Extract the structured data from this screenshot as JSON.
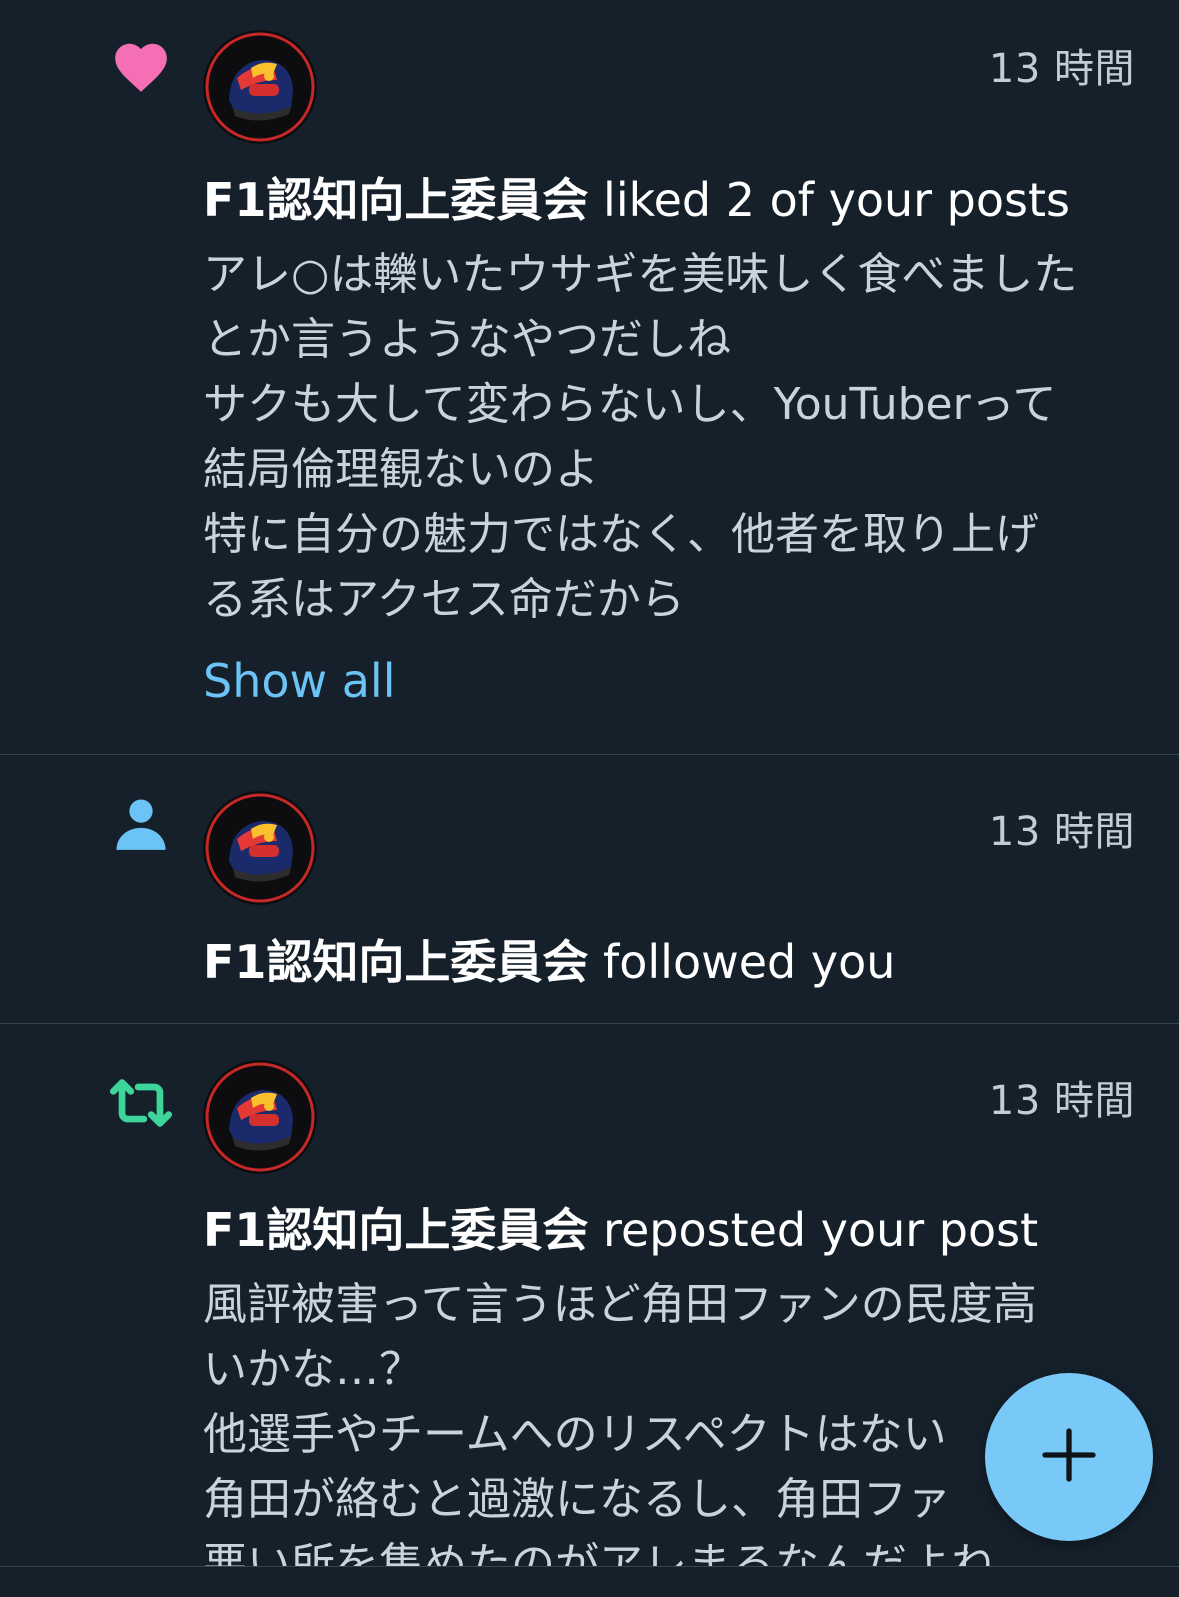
{
  "colors": {
    "background": "#15202b",
    "like": "#f46fb3",
    "follow": "#6cc4f6",
    "repost": "#3ed59a",
    "link": "#6cc4f6",
    "fab": "#79c9f8"
  },
  "notifications": [
    {
      "type": "like",
      "icon": "heart-icon",
      "time": "13 時間",
      "actor": "F1認知向上委員会",
      "action": " liked 2 of your posts",
      "body": "アレ○は轢いたウサギを美味しく食べました\nとか言うようなやつだしね\nサクも大して変わらないし、YouTuberって\n結局倫理観ないのよ\n特に自分の魅力ではなく、他者を取り上げ\nる系はアクセス命だから",
      "show_all": "Show all"
    },
    {
      "type": "follow",
      "icon": "person-icon",
      "time": "13 時間",
      "actor": "F1認知向上委員会",
      "action": " followed you"
    },
    {
      "type": "repost",
      "icon": "repost-icon",
      "time": "13 時間",
      "actor": "F1認知向上委員会",
      "action": " reposted your post",
      "body": "風評被害って言うほど角田ファンの民度高\nいかな…？\n他選手やチームへのリスペクトはない\n角田が絡むと過激になるし、角田ファ\n悪い所を集めたのがアレまるなんだよね"
    }
  ],
  "fab": {
    "icon": "plus-icon"
  }
}
